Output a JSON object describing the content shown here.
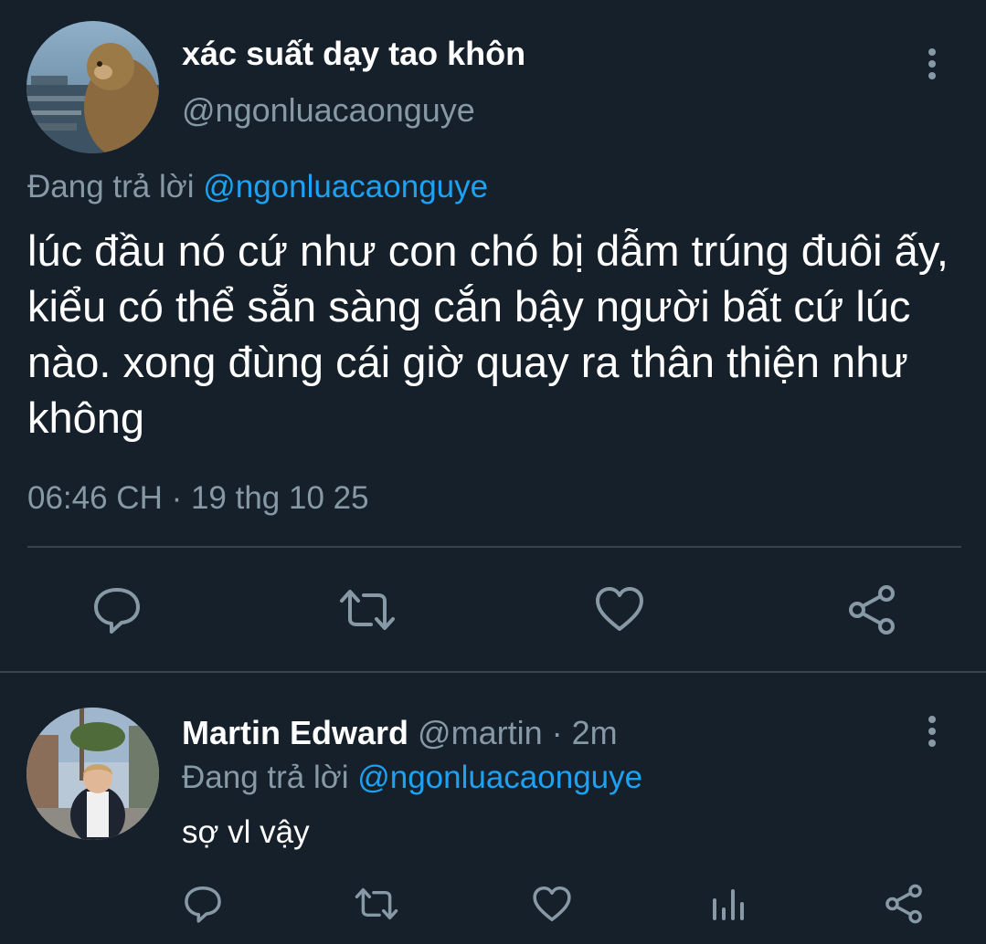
{
  "main_tweet": {
    "display_name": "xác suất dạy tao khôn",
    "handle": "@ngonluacaonguye",
    "reply_prefix": "Đang trả lời",
    "reply_to": "@ngonluacaonguye",
    "text": "lúc đầu nó cứ như con chó bị dẫm trúng đuôi ấy, kiểu có thể sẵn sàng cắn bậy người bất cứ lúc nào. xong đùng cái giờ quay ra thân thiện như không",
    "timestamp": "06:46 CH · 19 thg 10 25",
    "actions": [
      "reply-icon",
      "retweet-icon",
      "like-icon",
      "share-icon"
    ]
  },
  "reply": {
    "display_name": "Martin Edward",
    "handle": "@martin",
    "separator": "·",
    "time": "2m",
    "reply_prefix": "Đang trả lời",
    "reply_to": "@ngonluacaonguye",
    "text": "sợ vl vậy",
    "actions": [
      "reply-icon",
      "retweet-icon",
      "like-icon",
      "analytics-icon",
      "share-icon"
    ]
  },
  "colors": {
    "background": "#15202b",
    "muted": "#8899a6",
    "link": "#1da1f2",
    "divider": "#38444d"
  }
}
